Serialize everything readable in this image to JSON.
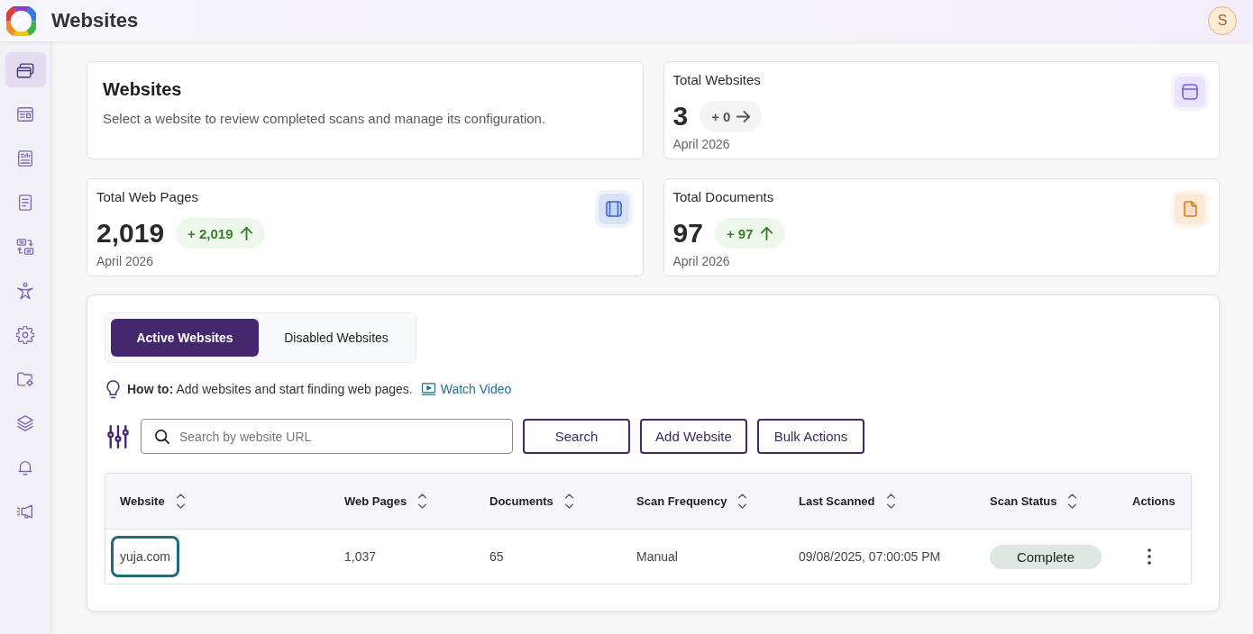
{
  "header": {
    "title": "Websites",
    "avatar": "S"
  },
  "sidebar": {
    "items": [
      {
        "selected": true
      },
      {
        "selected": false
      },
      {
        "selected": false
      },
      {
        "selected": false
      },
      {
        "selected": false
      },
      {
        "selected": false
      },
      {
        "selected": false
      },
      {
        "selected": false
      },
      {
        "selected": false
      },
      {
        "selected": false
      },
      {
        "selected": false
      }
    ]
  },
  "intro": {
    "title": "Websites",
    "description": "Select a website to review completed scans and manage its configuration."
  },
  "stats": [
    {
      "kind": "browser",
      "title": "Total Websites",
      "value": "3",
      "change": "+ 0",
      "increased": false,
      "period": "April 2026"
    },
    {
      "kind": "pages",
      "title": "Total Web Pages",
      "value": "2,019",
      "change": "+ 2,019",
      "increased": true,
      "period": "April 2026"
    },
    {
      "kind": "document",
      "title": "Total Documents",
      "value": "97",
      "change": "+ 97",
      "increased": true,
      "period": "April 2026"
    }
  ],
  "tabs": [
    {
      "label": "Active Websites",
      "selected": true
    },
    {
      "label": "Disabled Websites",
      "selected": false
    }
  ],
  "how_to": {
    "text": "**How to:** Add websites and start finding web pages.",
    "link": "Watch Video"
  },
  "search": {
    "placeholder": "Search by website URL"
  },
  "buttons": [
    "Search",
    "Add Website",
    "Bulk Actions"
  ],
  "table": {
    "columns": [
      {
        "label": "Website",
        "sortable": true
      },
      {
        "label": "Web Pages",
        "sortable": true
      },
      {
        "label": "Documents",
        "sortable": true
      },
      {
        "label": "Scan Frequency",
        "sortable": true
      },
      {
        "label": "Last Scanned",
        "sortable": true
      },
      {
        "label": "Scan Status",
        "sortable": true
      },
      {
        "label": "Actions",
        "sortable": false
      }
    ],
    "rows": [
      {
        "website": "yuja.com",
        "focused": true,
        "web_pages": "1,037",
        "documents": "65",
        "scan_frequency": "Manual",
        "last_scanned": "09/08/2025, 07:00:05 PM",
        "scan_status": "Complete"
      }
    ]
  }
}
